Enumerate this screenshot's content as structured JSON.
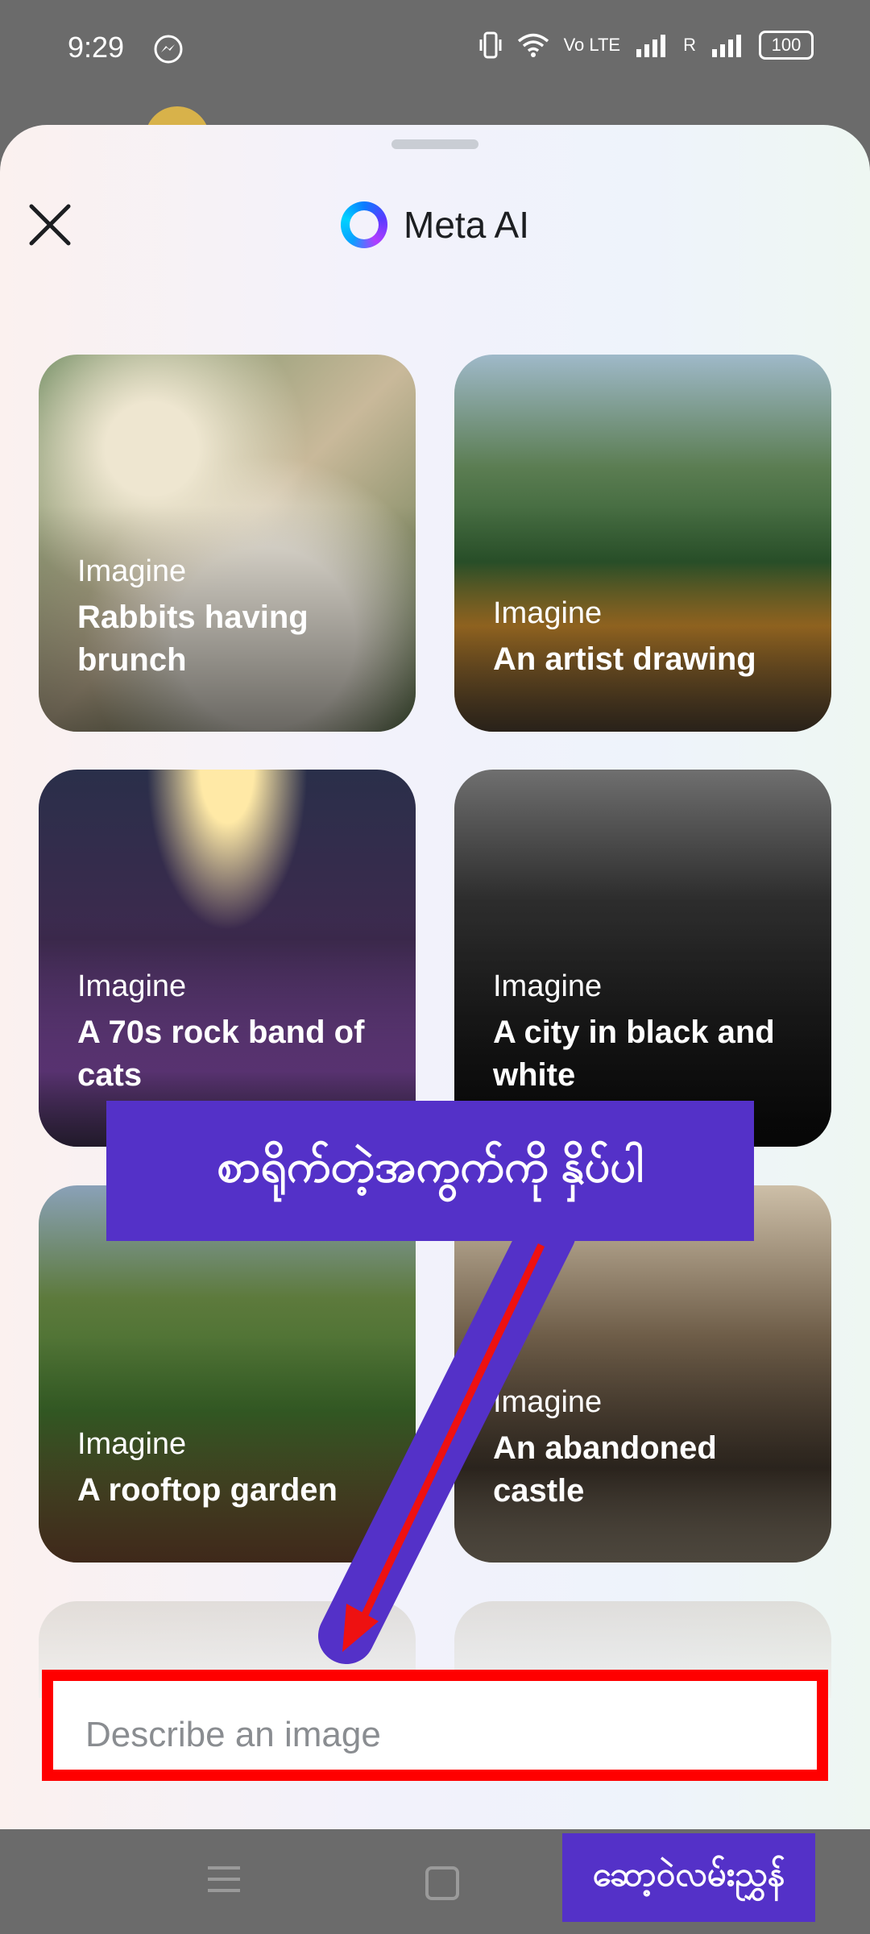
{
  "status_bar": {
    "time": "9:29",
    "network_1": "Vo LTE",
    "network_2": "R",
    "battery": "100"
  },
  "header": {
    "title": "Meta AI"
  },
  "cards": [
    {
      "kicker": "Imagine",
      "label": "Rabbits having brunch"
    },
    {
      "kicker": "Imagine",
      "label": "An artist drawing"
    },
    {
      "kicker": "Imagine",
      "label": "A 70s rock band of cats"
    },
    {
      "kicker": "Imagine",
      "label": "A city in black and white"
    },
    {
      "kicker": "Imagine",
      "label": "A rooftop garden"
    },
    {
      "kicker": "Imagine",
      "label": "An abandoned castle"
    }
  ],
  "input": {
    "placeholder": "Describe an image"
  },
  "annotation": {
    "callout_text": "စာရိုက်တဲ့အကွက်ကို နှိပ်ပါ",
    "nav_label": "ဆော့ဝဲလမ်းညွှန်",
    "callout_color": "#5431c8",
    "highlight_color": "#ff0000"
  }
}
